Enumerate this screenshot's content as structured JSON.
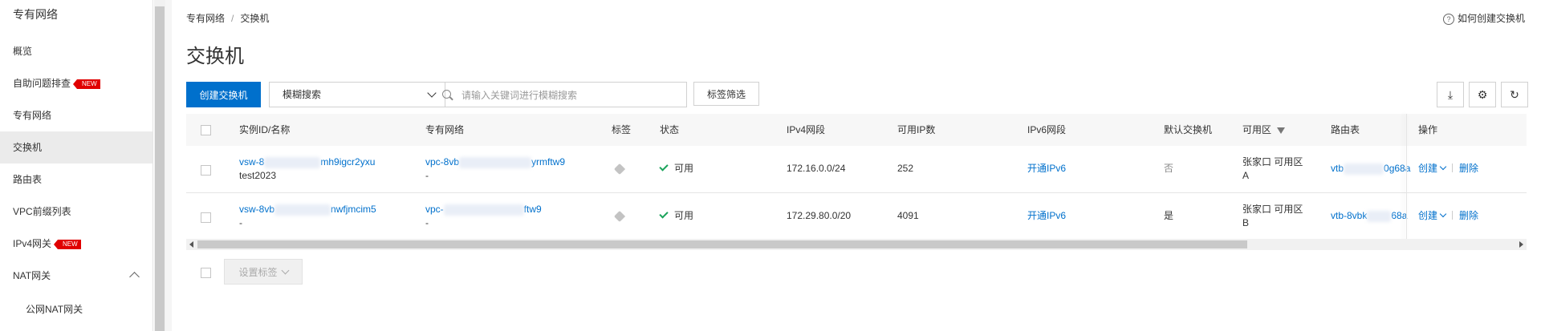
{
  "sidebar": {
    "title": "专有网络",
    "items": [
      {
        "label": "概览"
      },
      {
        "label": "自助问题排查",
        "badge": "NEW"
      },
      {
        "label": "专有网络"
      },
      {
        "label": "交换机"
      },
      {
        "label": "路由表"
      },
      {
        "label": "VPC前缀列表"
      },
      {
        "label": "IPv4网关",
        "badge": "NEW"
      },
      {
        "label": "NAT网关"
      },
      {
        "label": "公网NAT网关"
      }
    ]
  },
  "breadcrumb": {
    "root": "专有网络",
    "sep": "/",
    "current": "交换机"
  },
  "page_title": "交换机",
  "help_link": "如何创建交换机",
  "toolbar": {
    "create_label": "创建交换机",
    "search_mode": "模糊搜索",
    "search_placeholder": "请输入关键词进行模糊搜索",
    "tag_filter_label": "标签筛选"
  },
  "table": {
    "headers": [
      "实例ID/名称",
      "专有网络",
      "标签",
      "状态",
      "IPv4网段",
      "可用IP数",
      "IPv6网段",
      "默认交换机",
      "可用区",
      "路由表",
      "操作"
    ],
    "rows": [
      {
        "id_prefix": "vsw-8",
        "id_suffix": "mh9igcr2yxu",
        "name": "test2023",
        "vpc_prefix": "vpc-8vb",
        "vpc_suffix": "yrmftw9",
        "vpc_name": "-",
        "status": "可用",
        "ipv4": "172.16.0.0/24",
        "available_ips": "252",
        "ipv6": "开通IPv6",
        "default": "否",
        "zone_line1": "张家口 可用区",
        "zone_line2": "A",
        "route_prefix": "vtb",
        "route_suffix": "0g68a",
        "op_create": "创建",
        "op_delete": "删除"
      },
      {
        "id_prefix": "vsw-8vb",
        "id_suffix": "nwfjmcim5",
        "name": "-",
        "vpc_prefix": "vpc-",
        "vpc_suffix": "ftw9",
        "vpc_name": "-",
        "status": "可用",
        "ipv4": "172.29.80.0/20",
        "available_ips": "4091",
        "ipv6": "开通IPv6",
        "default": "是",
        "zone_line1": "张家口 可用区",
        "zone_line2": "B",
        "route_prefix": "vtb-8vbk",
        "route_suffix": "68a",
        "op_create": "创建",
        "op_delete": "删除"
      }
    ]
  },
  "footer": {
    "set_tag_label": "设置标签"
  },
  "colors": {
    "primary": "#0070cc",
    "status_ok": "#1aa35b",
    "badge": "#e00000"
  }
}
